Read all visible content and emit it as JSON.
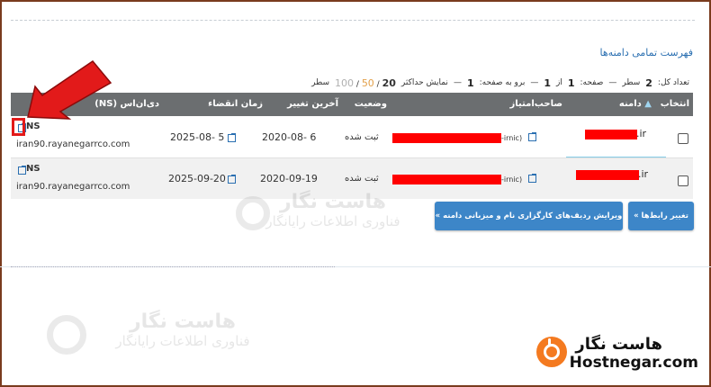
{
  "page": {
    "title": "فهرست تمامی دامنه‌ها"
  },
  "paging": {
    "total_label": "تعداد کل:",
    "total_value": "2",
    "total_unit": "سطر",
    "page_label": "صفحه:",
    "page_value": "1",
    "page_of": "از",
    "page_total": "1",
    "goto_label": "برو به صفحه:",
    "goto_value": "1",
    "show_max_label": "نمایش حداکثر",
    "limit_20": "20",
    "limit_50": "50",
    "limit_100": "100",
    "limit_unit": "سطر"
  },
  "table": {
    "headers": {
      "select": "انتخاب",
      "domain": "دامنه",
      "owner": "صاحب‌امتیاز",
      "status": "وضعیت",
      "last_change": "آخرین تغییر",
      "expiry": "زمان انقضاء",
      "dns": "دی‌ان‌اس (NS)"
    },
    "rows": [
      {
        "domain": ".ir",
        "owner_suffix": "-irnic)",
        "status": "ثبت شده",
        "last_change": "2020-08- 6",
        "expiry": "2025-08- 5",
        "ns_label": "NS",
        "ns_host": "iran90.rayanegarrco.com"
      },
      {
        "domain": ".ir",
        "owner_suffix": "-irnic)",
        "status": "ثبت شده",
        "last_change": "2020-09-19",
        "expiry": "2025-09-20",
        "ns_label": "NS",
        "ns_host": "iran90.rayanegarrco.com"
      }
    ]
  },
  "buttons": {
    "change_ns": "تغییر رابط‌ها »",
    "edit_records": "ویرایش ردیف‌های کارگزاری نام و میزبانی دامنه »"
  },
  "watermark": {
    "name_fa": "هاست نگار",
    "tagline_fa": "فناوری اطلاعات رایانگار"
  },
  "brand": {
    "name_fa": "هاست نگار",
    "name_en": "Hostnegar.com"
  },
  "colors": {
    "header_bg": "#6b6e70",
    "link": "#2a6fb1",
    "button": "#3d86c8",
    "domain_highlight": "#86cde8",
    "redaction": "#ff0000",
    "arrow": "#e21a1a",
    "brand_orange": "#f47a20"
  }
}
